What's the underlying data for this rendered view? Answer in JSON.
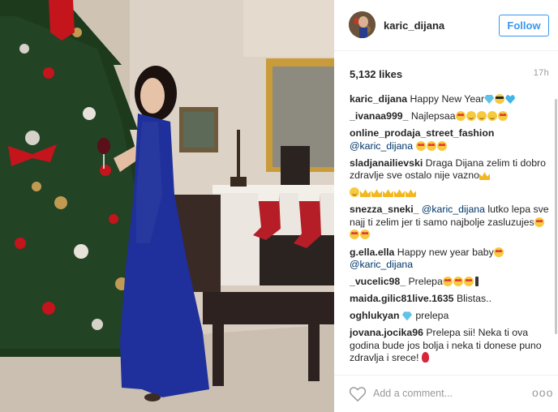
{
  "post": {
    "username": "karic_dijana",
    "follow_label": "Follow",
    "likes": "5,132 likes",
    "time": "17h"
  },
  "comments": [
    {
      "user": "karic_dijana",
      "parts": [
        {
          "t": "text",
          "v": " Happy New Year"
        },
        {
          "t": "emoji",
          "v": "gem"
        },
        {
          "t": "emoji",
          "v": "shades"
        },
        {
          "t": "emoji",
          "v": "heart"
        }
      ]
    },
    {
      "user": "_ivanaa999_",
      "parts": [
        {
          "t": "text",
          "v": " Najlepsaa"
        },
        {
          "t": "emoji",
          "v": "heart-eyes"
        },
        {
          "t": "emoji",
          "v": "smile"
        },
        {
          "t": "emoji",
          "v": "smile"
        },
        {
          "t": "emoji",
          "v": "smile"
        },
        {
          "t": "emoji",
          "v": "heart-eyes"
        }
      ]
    },
    {
      "user": "online_prodaja_street_fashion",
      "parts": [
        {
          "t": "mention",
          "v": " @karic_dijana"
        },
        {
          "t": "text",
          "v": " "
        },
        {
          "t": "emoji",
          "v": "heart-eyes"
        },
        {
          "t": "emoji",
          "v": "heart-eyes"
        },
        {
          "t": "emoji",
          "v": "heart-eyes"
        }
      ]
    },
    {
      "user": "sladjanailievski",
      "parts": [
        {
          "t": "text",
          "v": " Draga Dijana zelim ti dobro zdravlje sve ostalo nije vazno"
        },
        {
          "t": "emoji",
          "v": "crown"
        }
      ]
    },
    {
      "user": "",
      "parts": [
        {
          "t": "emoji",
          "v": "smile"
        },
        {
          "t": "emoji",
          "v": "crown"
        },
        {
          "t": "emoji",
          "v": "crown"
        },
        {
          "t": "emoji",
          "v": "crown"
        },
        {
          "t": "emoji",
          "v": "crown"
        },
        {
          "t": "emoji",
          "v": "crown"
        }
      ]
    },
    {
      "user": "snezza_sneki_",
      "parts": [
        {
          "t": "text",
          "v": " "
        },
        {
          "t": "mention",
          "v": "@karic_dijana"
        },
        {
          "t": "text",
          "v": " lutko lepa sve najj ti zelim jer ti samo najbolje zasluzujes"
        },
        {
          "t": "emoji",
          "v": "heart-eyes"
        },
        {
          "t": "emoji",
          "v": "heart-eyes"
        },
        {
          "t": "emoji",
          "v": "heart-eyes"
        }
      ]
    },
    {
      "user": "g.ella.ella",
      "parts": [
        {
          "t": "text",
          "v": " Happy new year baby"
        },
        {
          "t": "emoji",
          "v": "heart-eyes"
        },
        {
          "t": "text",
          "v": " "
        },
        {
          "t": "mention",
          "v": "@karic_dijana"
        }
      ]
    },
    {
      "user": "_vucelic98_",
      "parts": [
        {
          "t": "text",
          "v": " Prelepa"
        },
        {
          "t": "emoji",
          "v": "heart-eyes"
        },
        {
          "t": "emoji",
          "v": "heart-eyes"
        },
        {
          "t": "emoji",
          "v": "heart-eyes"
        },
        {
          "t": "emoji",
          "v": "bang"
        }
      ]
    },
    {
      "user": "maida.gilic81live.1635",
      "parts": [
        {
          "t": "text",
          "v": " Blistas.."
        }
      ]
    },
    {
      "user": "oghlukyan",
      "parts": [
        {
          "t": "text",
          "v": " "
        },
        {
          "t": "emoji",
          "v": "gem"
        },
        {
          "t": "text",
          "v": " prelepa"
        }
      ]
    },
    {
      "user": "jovana.jocika96",
      "parts": [
        {
          "t": "text",
          "v": " Prelepa sii! Neka ti ova godina bude jos bolja i neka ti donese puno zdravlja i srece! "
        },
        {
          "t": "emoji",
          "v": "rose"
        }
      ]
    }
  ],
  "footer": {
    "comment_placeholder": "Add a comment...",
    "more_label": "ooo"
  }
}
